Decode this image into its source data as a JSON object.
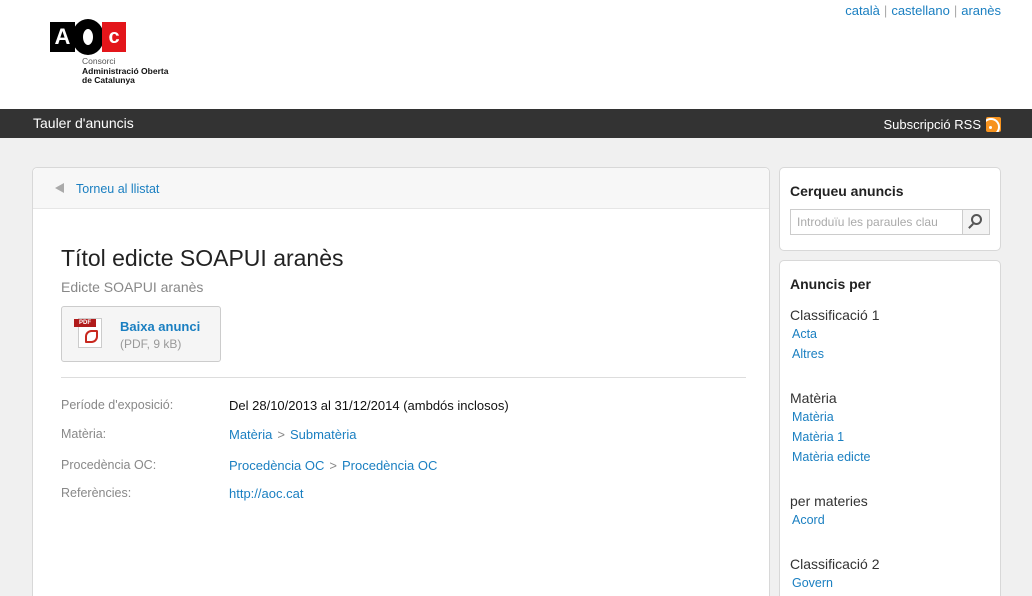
{
  "header": {
    "logo": {
      "letters": "AOC",
      "line1": "Consorci",
      "line2": "Administració Oberta",
      "line3": "de Catalunya"
    },
    "languages": [
      "català",
      "castellano",
      "aranès"
    ]
  },
  "topbar": {
    "title": "Tauler d'anuncis",
    "rss_label": "Subscripció RSS"
  },
  "main": {
    "back_label": "Torneu al llistat",
    "title": "Títol edicte SOAPUI aranès",
    "subtitle": "Edicte SOAPUI aranès",
    "download": {
      "label": "Baixa anunci",
      "meta": "(PDF, 9 kB)",
      "icon_text": "PDF"
    },
    "details": {
      "period_label": "Període d'exposició:",
      "period_value": "Del 28/10/2013 al 31/12/2014 (ambdós inclosos)",
      "subject_label": "Matèria:",
      "subject_value": "Matèria",
      "subject_sub": "Submatèria",
      "origin_label": "Procedència OC:",
      "origin_value": "Procedència OC",
      "origin_sub": "Procedència OC",
      "refs_label": "Referències:",
      "refs_value": "http://aoc.cat"
    }
  },
  "search": {
    "title": "Cerqueu anuncis",
    "placeholder": "Introduïu les paraules clau"
  },
  "filters": {
    "title": "Anuncis per",
    "groups": [
      {
        "title": "Classificació 1",
        "items": [
          "Acta",
          "Altres"
        ]
      },
      {
        "title": "Matèria",
        "items": [
          "Matèria",
          "Matèria 1",
          "Matèria edicte"
        ]
      },
      {
        "title": "per materies",
        "items": [
          "Acord"
        ]
      },
      {
        "title": "Classificació 2",
        "items": [
          "Govern"
        ]
      }
    ]
  },
  "colors": {
    "link": "#1a7fc1",
    "topbar": "#333333",
    "rss": "#f7931e",
    "logo_red": "#e3151a"
  }
}
